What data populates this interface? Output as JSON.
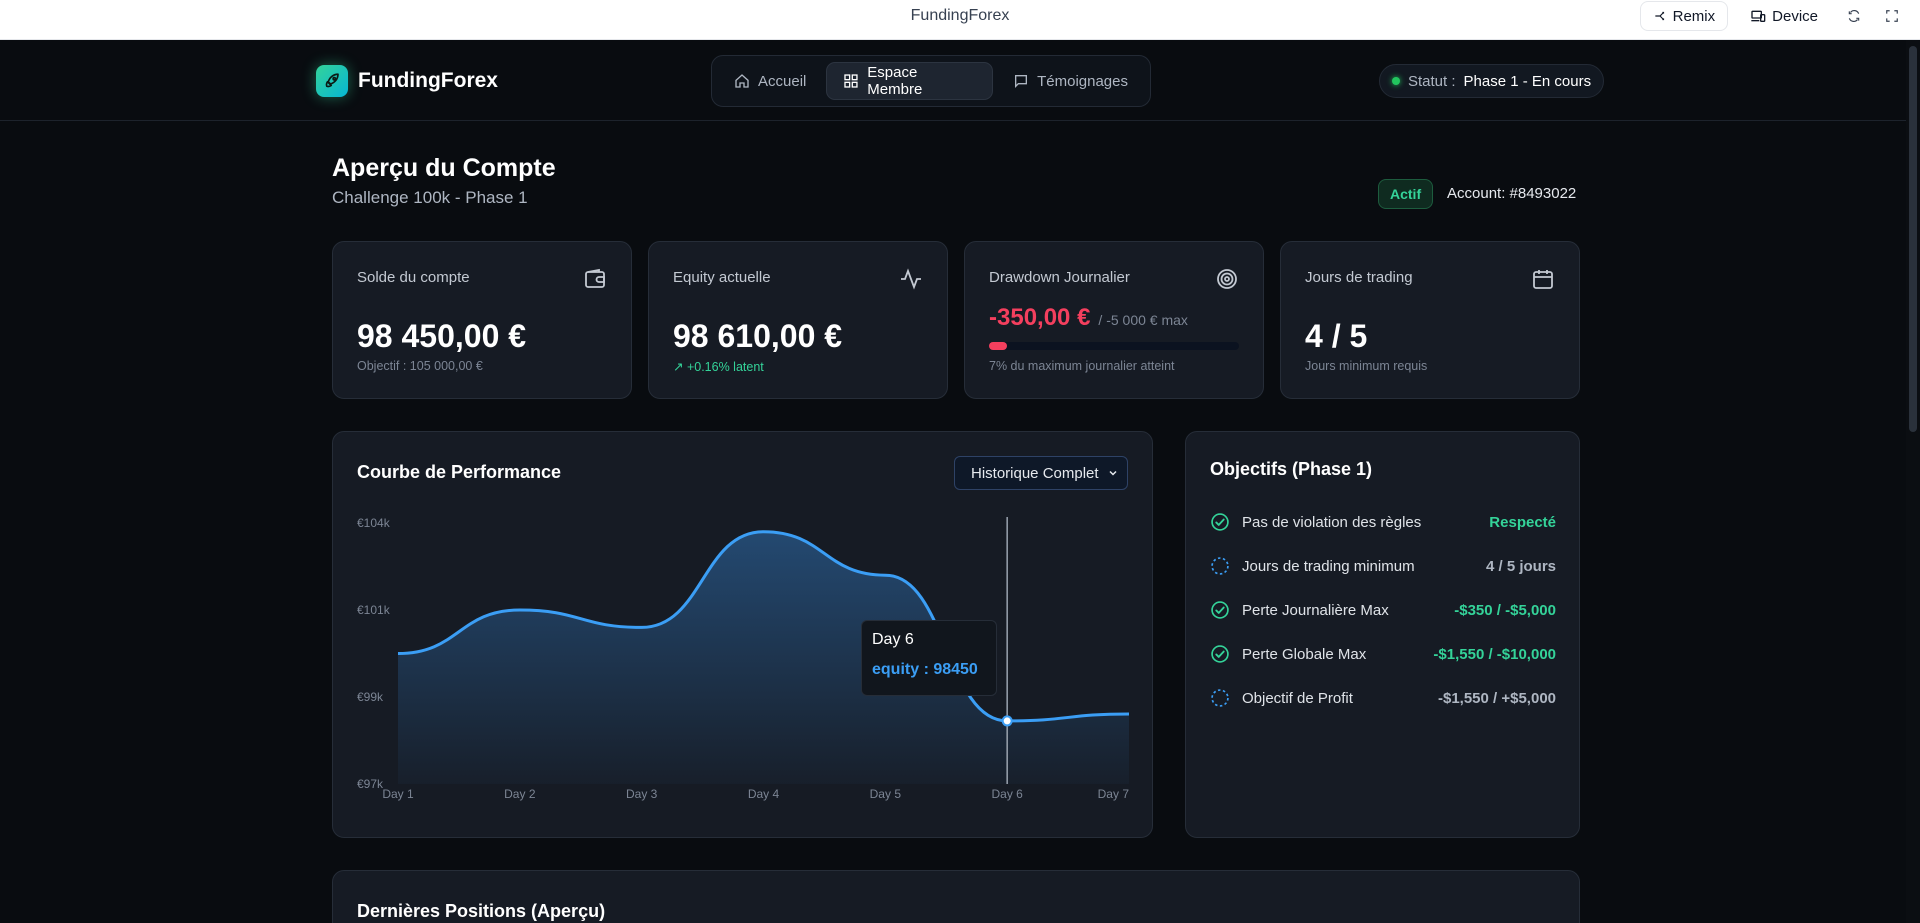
{
  "browser": {
    "title": "FundingForex",
    "remix_label": "Remix",
    "device_label": "Device"
  },
  "header": {
    "brand": "FundingForex",
    "nav": [
      {
        "label": "Accueil",
        "icon": "home-icon"
      },
      {
        "label": "Espace Membre",
        "icon": "grid-icon"
      },
      {
        "label": "Témoignages",
        "icon": "message-icon"
      }
    ],
    "status_label": "Statut :",
    "status_value": "Phase 1 - En cours"
  },
  "page": {
    "title": "Aperçu du Compte",
    "subtitle": "Challenge 100k - Phase 1",
    "badge": "Actif",
    "account": "Account: #8493022"
  },
  "stats": [
    {
      "label": "Solde du compte",
      "value": "98 450,00 €",
      "sub": "Objectif : 105 000,00 €",
      "icon": "wallet-icon"
    },
    {
      "label": "Equity actuelle",
      "value": "98 610,00 €",
      "sub": "↗ +0.16% latent",
      "icon": "activity-icon"
    },
    {
      "label": "Drawdown Journalier",
      "value": "-350,00 €",
      "max": "/ -5 000 € max",
      "sub": "7% du maximum journalier atteint",
      "progress": 0.07,
      "icon": "target-icon"
    },
    {
      "label": "Jours de trading",
      "value": "4 / 5",
      "sub": "Jours minimum requis",
      "icon": "calendar-icon"
    }
  ],
  "chart": {
    "title": "Courbe de Performance",
    "filter": "Historique Complet",
    "tooltip_day": "Day 6",
    "tooltip_value": "equity : 98450"
  },
  "chart_data": {
    "type": "area",
    "x": [
      "Day 1",
      "Day 2",
      "Day 3",
      "Day 4",
      "Day 5",
      "Day 6",
      "Day 7"
    ],
    "series": [
      {
        "name": "equity",
        "values": [
          100000,
          101000,
          100600,
          102800,
          101800,
          98450,
          98610
        ]
      }
    ],
    "yticks": [
      "€97k",
      "€99k",
      "€101k",
      "€104k"
    ],
    "ytick_values": [
      97000,
      99000,
      101000,
      103000
    ],
    "ylim": [
      97000,
      103000
    ],
    "highlight_index": 5
  },
  "objectives": {
    "title": "Objectifs (Phase 1)",
    "items": [
      {
        "label": "Pas de violation des règles",
        "value": "Respecté",
        "done": true
      },
      {
        "label": "Jours de trading minimum",
        "value": "4 / 5 jours",
        "done": false
      },
      {
        "label": "Perte Journalière Max",
        "value": "-$350 / -$5,000",
        "done": true
      },
      {
        "label": "Perte Globale Max",
        "value": "-$1,550 / -$10,000",
        "done": true
      },
      {
        "label": "Objectif de Profit",
        "value": "-$1,550 / +$5,000",
        "done": false
      }
    ]
  },
  "positions": {
    "title": "Dernières Positions (Aperçu)"
  },
  "colors": {
    "accent": "#3b9ef5",
    "positive": "#34d399",
    "negative": "#f43f5e",
    "background": "#090c10",
    "card": "#161b24"
  }
}
